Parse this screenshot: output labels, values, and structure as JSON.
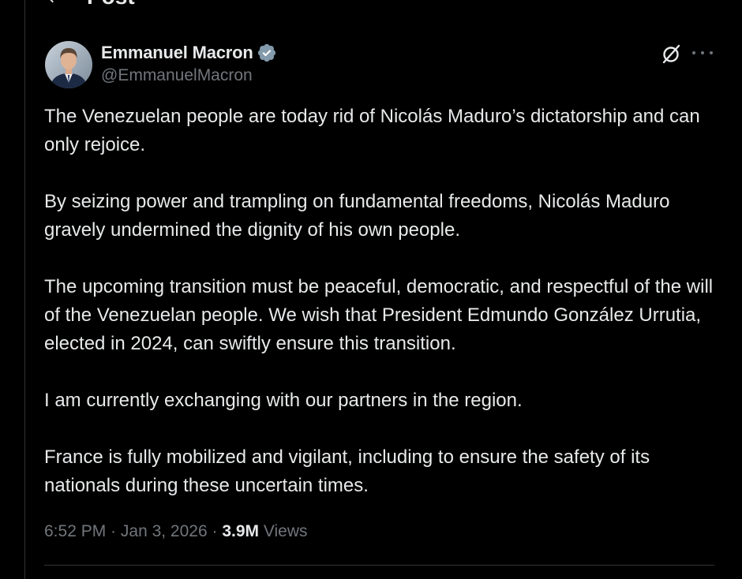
{
  "header": {
    "title": "Post"
  },
  "author": {
    "display_name": "Emmanuel Macron",
    "handle": "@EmmanuelMacron",
    "verified": true,
    "badge_color": "#1d9bf0"
  },
  "post": {
    "paragraphs": [
      "The Venezuelan people are today rid of Nicolás Maduro’s dictatorship and can only rejoice.",
      "By seizing power and trampling on fundamental freedoms, Nicolás Maduro gravely undermined the dignity of his own people.",
      "The upcoming transition must be peaceful, democratic, and respectful of the will of the Venezuelan people. We wish that President Edmundo González Urrutia, elected in 2024, can swiftly ensure this transition.",
      "I am currently exchanging with our partners in the region.",
      "France is fully mobilized and vigilant, including to ensure the safety of its nationals during these uncertain times."
    ],
    "time": "6:52 PM",
    "separator": " · ",
    "date": "Jan 3, 2026",
    "views_count": "3.9M",
    "views_label": " Views"
  },
  "icons": {
    "back": "arrow-left-icon",
    "verified": "verified-badge-icon",
    "grok": "grok-icon",
    "more": "more-horizontal-icon"
  },
  "colors": {
    "background": "#000000",
    "text_primary": "#e7e9ea",
    "text_secondary": "#71767b",
    "border": "#2f3336"
  }
}
